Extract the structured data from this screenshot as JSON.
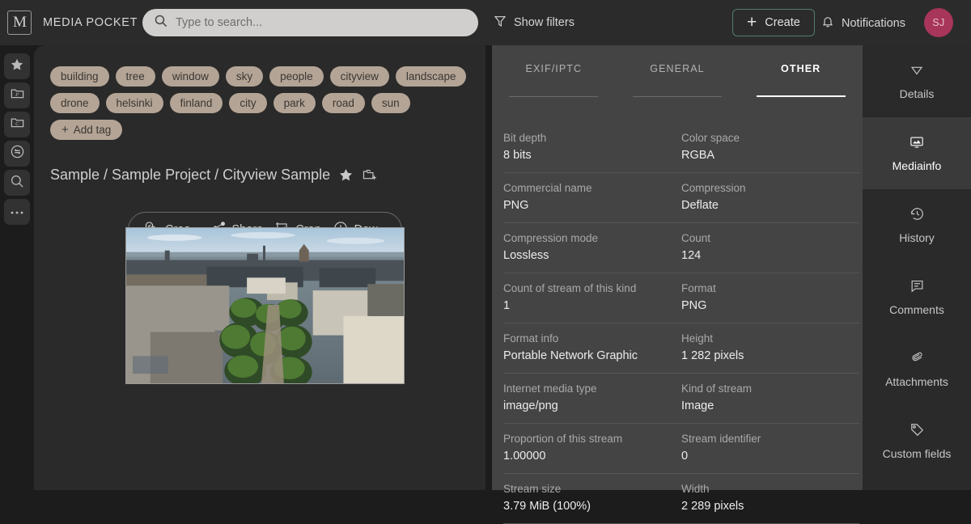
{
  "app": {
    "logo_letter": "M",
    "title": "MEDIA POCKET"
  },
  "search": {
    "placeholder": "Type to search...",
    "value": "",
    "icon": "search-icon"
  },
  "header": {
    "show_filters": "Show filters",
    "show_filters_icon": "funnel-icon",
    "create": "Create",
    "create_icon": "plus-icon",
    "create_border_color": "#4f7d70",
    "notifications": "Notifications",
    "notifications_icon": "bell-icon",
    "avatar_initials": "SJ",
    "avatar_color": "#a8355a"
  },
  "rail": {
    "items": [
      {
        "name": "favorites",
        "icon": "star-icon"
      },
      {
        "name": "projects-folder",
        "icon": "folder-p-icon"
      },
      {
        "name": "collections-folder",
        "icon": "folder-c-icon"
      },
      {
        "name": "transfers",
        "icon": "transfer-icon"
      },
      {
        "name": "search",
        "icon": "search-icon"
      },
      {
        "name": "more",
        "icon": "ellipsis-icon"
      }
    ]
  },
  "tags": {
    "items": [
      "building",
      "tree",
      "window",
      "sky",
      "people",
      "cityview",
      "landscape",
      "drone",
      "helsinki",
      "finland",
      "city",
      "park",
      "road",
      "sun"
    ],
    "add_label": "Add tag",
    "add_icon": "plus-icon",
    "pill_color": "#b3a496"
  },
  "breadcrumb": {
    "text": "Sample / Sample Project / Cityview Sample",
    "star_icon": "star-icon",
    "add_to_collection_icon": "add-to-collection-icon"
  },
  "actions": {
    "items": [
      {
        "label": "Crea...",
        "icon": "approval-icon",
        "name": "create-approval-button"
      },
      {
        "label": "Share",
        "icon": "share-icon",
        "name": "share-button"
      },
      {
        "label": "Crop",
        "icon": "crop-icon",
        "name": "crop-button"
      },
      {
        "label": "Dow...",
        "icon": "download-cloud-icon",
        "name": "download-button"
      }
    ]
  },
  "preview": {
    "alt": "Aerial cityscape of Helsinki Esplanadi park with trees and buildings"
  },
  "metadata": {
    "tabs": [
      {
        "label": "EXIF/IPTC",
        "active": false
      },
      {
        "label": "GENERAL",
        "active": false
      },
      {
        "label": "OTHER",
        "active": true
      }
    ],
    "rows": [
      {
        "left_key": "Bit depth",
        "left_value": "8 bits",
        "right_key": "Color space",
        "right_value": "RGBA"
      },
      {
        "left_key": "Commercial name",
        "left_value": "PNG",
        "right_key": "Compression",
        "right_value": "Deflate"
      },
      {
        "left_key": "Compression mode",
        "left_value": "Lossless",
        "right_key": "Count",
        "right_value": "124"
      },
      {
        "left_key": "Count of stream of this kind",
        "left_value": "1",
        "right_key": "Format",
        "right_value": "PNG"
      },
      {
        "left_key": "Format info",
        "left_value": "Portable Network Graphic",
        "right_key": "Height",
        "right_value": "1 282 pixels"
      },
      {
        "left_key": "Internet media type",
        "left_value": "image/png",
        "right_key": "Kind of stream",
        "right_value": "Image"
      },
      {
        "left_key": "Proportion of this stream",
        "left_value": "1.00000",
        "right_key": "Stream identifier",
        "right_value": "0"
      },
      {
        "left_key": "Stream size",
        "left_value": "3.79 MiB (100%)",
        "right_key": "Width",
        "right_value": "2 289 pixels"
      }
    ]
  },
  "right_nav": {
    "items": [
      {
        "label": "Details",
        "icon": "chevron-down-icon",
        "active": false
      },
      {
        "label": "Mediainfo",
        "icon": "monitor-image-icon",
        "active": true
      },
      {
        "label": "History",
        "icon": "clock-history-icon",
        "active": false
      },
      {
        "label": "Comments",
        "icon": "comment-icon",
        "active": false
      },
      {
        "label": "Attachments",
        "icon": "paperclip-icon",
        "active": false
      },
      {
        "label": "Custom fields",
        "icon": "tag-icon",
        "active": false
      }
    ]
  }
}
